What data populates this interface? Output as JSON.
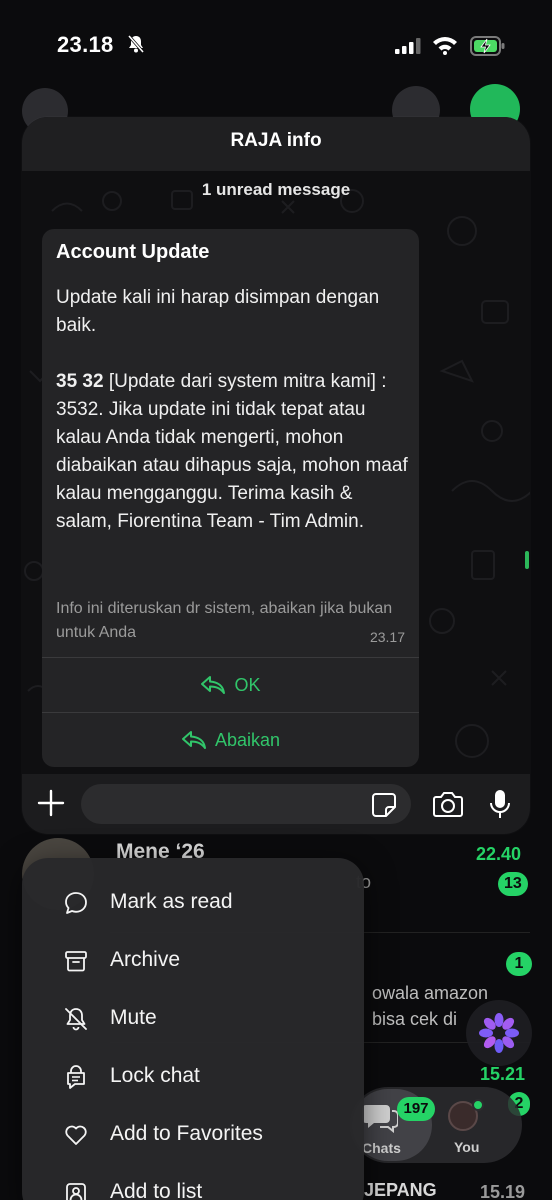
{
  "status_bar": {
    "time": "23.18"
  },
  "background_chats": [
    {
      "title": "Mene ‘26",
      "time": "22.40",
      "snippet": "to",
      "badge": "13"
    },
    {
      "title": "",
      "time": "",
      "snippet": "owala amazon",
      "snippet2": "bisa cek di",
      "badge": "1"
    },
    {
      "title": "",
      "time": "15.21",
      "snippet": "",
      "badge": "2"
    },
    {
      "title": "JEPANG",
      "time": "15.19",
      "snippet": "",
      "badge": ""
    }
  ],
  "preview": {
    "header_title": "RAJA info",
    "unread_label": "1 unread message",
    "message": {
      "title": "Account Update",
      "paragraph1": "Update kali ini harap disimpan dengan baik.",
      "code": "35 32",
      "paragraph2": " [Update dari system mitra kami] : 3532. Jika update ini tidak tepat atau kalau Anda tidak mengerti, mohon diabaikan atau dihapus saja, mohon maaf kalau mengganggu. Terima kasih & salam,  Fiorentina Team - Tim Admin.",
      "footer": "Info ini diteruskan dr sistem, abaikan jika bukan untuk Anda",
      "timestamp": "23.17",
      "actions": [
        "OK",
        "Abaikan"
      ]
    }
  },
  "context_menu": {
    "items": [
      {
        "label": "Mark as read",
        "icon": "chat-bubble-icon"
      },
      {
        "label": "Archive",
        "icon": "archive-icon"
      },
      {
        "label": "Mute",
        "icon": "bell-slash-icon"
      },
      {
        "label": "Lock chat",
        "icon": "lock-chat-icon"
      },
      {
        "label": "Add to Favorites",
        "icon": "heart-icon"
      },
      {
        "label": "Add to list",
        "icon": "add-to-list-icon"
      }
    ]
  },
  "tab_bar": {
    "chats_label": "Chats",
    "chats_badge": "197",
    "you_label": "You"
  },
  "colors": {
    "accent": "#25d366",
    "action_text": "#31c56a",
    "bubble": "#242426",
    "menu": "#28282a"
  }
}
